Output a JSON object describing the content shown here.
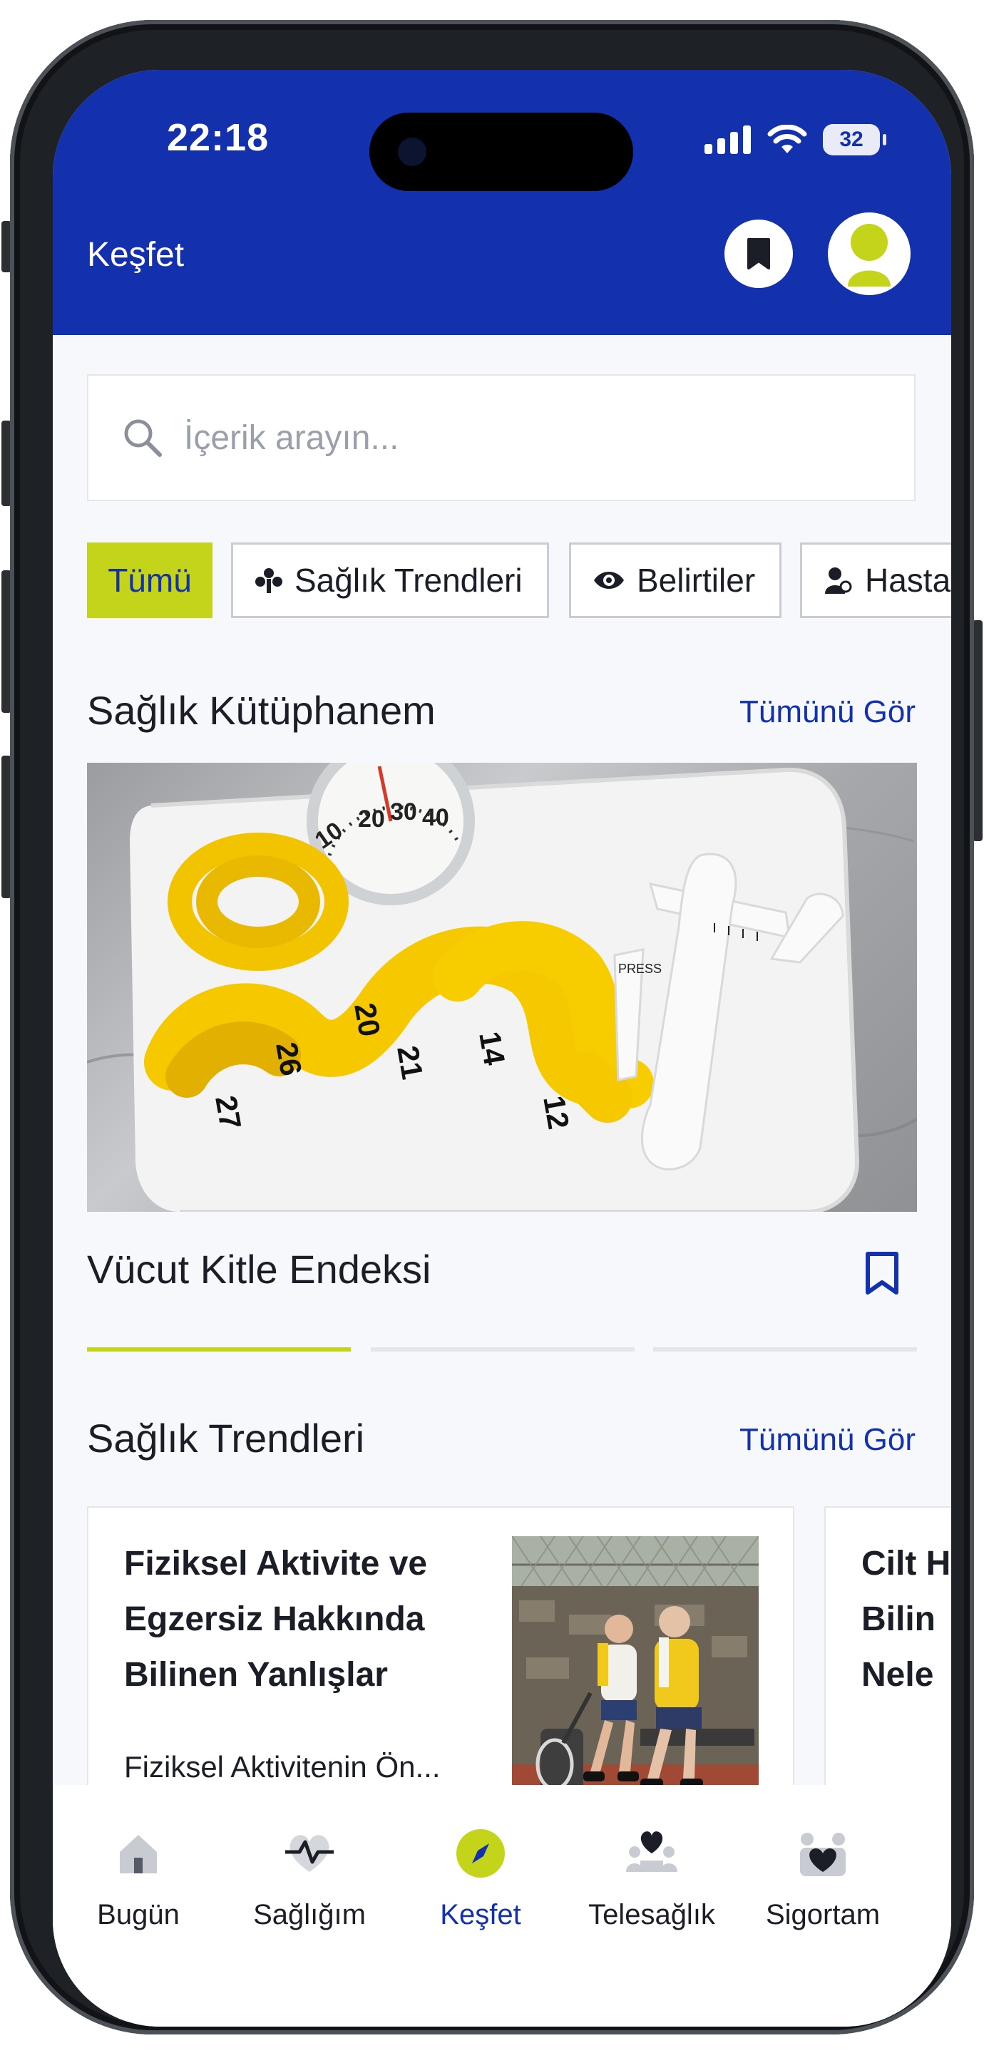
{
  "status_bar": {
    "time": "22:18",
    "battery": "32"
  },
  "header": {
    "title": "Keşfet",
    "bookmark_icon": "bookmark-icon",
    "avatar_icon": "user-avatar-icon"
  },
  "search": {
    "placeholder": "İçerik arayın...",
    "value": ""
  },
  "chips": [
    {
      "label": "Tümü",
      "active": true
    },
    {
      "label": "Sağlık Trendleri",
      "icon": "trends-icon"
    },
    {
      "label": "Belirtiler",
      "icon": "eye-icon"
    },
    {
      "label": "Hasta",
      "icon": "person-search-icon"
    }
  ],
  "library": {
    "title": "Sağlık Kütüphanem",
    "see_all": "Tümünü Gör",
    "item_title": "Vücut Kitle Endeksi",
    "carousel_page": 1,
    "carousel_total": 3
  },
  "trends": {
    "title": "Sağlık Trendleri",
    "see_all": "Tümünü Gör",
    "cards": [
      {
        "title": "Fiziksel Aktivite ve Egzersiz Hakkında Bilinen Yanlışlar",
        "subtitle": "Fiziksel Aktivitenin Ön..."
      },
      {
        "title": "Cilt Hak Bilin Nele"
      }
    ]
  },
  "tabbar": [
    {
      "label": "Bugün",
      "icon": "home-icon"
    },
    {
      "label": "Sağlığım",
      "icon": "heartbeat-icon"
    },
    {
      "label": "Keşfet",
      "icon": "compass-icon",
      "active": true
    },
    {
      "label": "Telesağlık",
      "icon": "telehealth-icon"
    },
    {
      "label": "Sigortam",
      "icon": "insurance-icon"
    }
  ],
  "colors": {
    "brand": "#1330ad",
    "accent": "#c3d41a",
    "background": "#f7f8fb"
  }
}
